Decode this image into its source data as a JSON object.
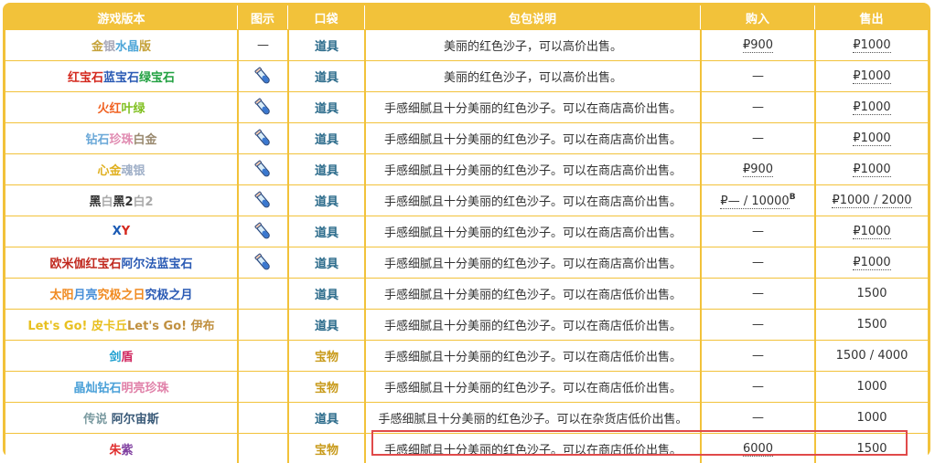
{
  "headers": [
    "游戏版本",
    "图示",
    "口袋",
    "包包说明",
    "购入",
    "售出"
  ],
  "rows": [
    {
      "version": [
        [
          "金",
          "#c5a23a"
        ],
        [
          "银",
          "#a8a8b8"
        ],
        [
          "水晶",
          "#4ea6d8"
        ],
        [
          "版",
          "#c5a23a"
        ]
      ],
      "icon": false,
      "icon_text": "—",
      "pocket": "道具",
      "pocket_type": "item",
      "desc": "美丽的红色沙子，可以高价出售。",
      "buy": "₽900",
      "sell": "₽1000"
    },
    {
      "version": [
        [
          "红宝石",
          "#d4281e"
        ],
        [
          "蓝宝石",
          "#2a5ab4"
        ],
        [
          "绿宝石",
          "#20a040"
        ]
      ],
      "icon": true,
      "pocket": "道具",
      "pocket_type": "item",
      "desc": "美丽的红色沙子，可以高价出售。",
      "buy": "—",
      "sell": "₽1000"
    },
    {
      "version": [
        [
          "火红",
          "#f06020"
        ],
        [
          "叶绿",
          "#80c020"
        ]
      ],
      "icon": true,
      "pocket": "道具",
      "pocket_type": "item",
      "desc": "手感细腻且十分美丽的红色沙子。可以在商店高价出售。",
      "buy": "—",
      "sell": "₽1000"
    },
    {
      "version": [
        [
          "钻石",
          "#6aa8d8"
        ],
        [
          "珍珠",
          "#e08ab0"
        ],
        [
          "白金",
          "#9a8a70"
        ]
      ],
      "icon": true,
      "pocket": "道具",
      "pocket_type": "item",
      "desc": "手感细腻且十分美丽的红色沙子。可以在商店高价出售。",
      "buy": "—",
      "sell": "₽1000"
    },
    {
      "version": [
        [
          "心金",
          "#e0b020"
        ],
        [
          "魂银",
          "#a0b0c8"
        ]
      ],
      "icon": true,
      "pocket": "道具",
      "pocket_type": "item",
      "desc": "手感细腻且十分美丽的红色沙子。可以在商店高价出售。",
      "buy": "₽900",
      "sell": "₽1000"
    },
    {
      "version": [
        [
          "黑",
          "#333333"
        ],
        [
          "白",
          "#aaaaaa"
        ],
        [
          "黑2",
          "#333333"
        ],
        [
          "白2",
          "#aaaaaa"
        ]
      ],
      "icon": true,
      "pocket": "道具",
      "pocket_type": "item",
      "desc": "手感细腻且十分美丽的红色沙子。可以在商店高价出售。",
      "buy": "₽— / 10000",
      "buy_sup": "B",
      "sell": "₽1000 / 2000"
    },
    {
      "version": [
        [
          "X",
          "#1a5ab4"
        ],
        [
          "Y",
          "#d4281e"
        ]
      ],
      "icon": true,
      "pocket": "道具",
      "pocket_type": "item",
      "desc": "手感细腻且十分美丽的红色沙子。可以在商店高价出售。",
      "buy": "—",
      "sell": "₽1000"
    },
    {
      "version": [
        [
          "欧米伽红宝石",
          "#c0281e"
        ],
        [
          "阿尔法蓝宝石",
          "#2a5ab4"
        ]
      ],
      "icon": true,
      "pocket": "道具",
      "pocket_type": "item",
      "desc": "手感细腻且十分美丽的红色沙子。可以在商店高价出售。",
      "buy": "—",
      "sell": "₽1000"
    },
    {
      "version": [
        [
          "太阳",
          "#f08a20"
        ],
        [
          "月亮",
          "#4a90d8"
        ],
        [
          "究极之日",
          "#f08a20"
        ],
        [
          "究极之月",
          "#2a5ab4"
        ]
      ],
      "icon": false,
      "pocket": "道具",
      "pocket_type": "item",
      "desc": "手感细腻且十分美丽的红色沙子。可以在商店低价出售。",
      "buy": "—",
      "sell": "1500"
    },
    {
      "version": [
        [
          "Let's Go! 皮卡丘",
          "#e8c020"
        ],
        [
          "Let's Go! 伊布",
          "#c09040"
        ]
      ],
      "icon": false,
      "pocket": "道具",
      "pocket_type": "item",
      "desc": "手感细腻且十分美丽的红色沙子。可以在商店低价出售。",
      "buy": "—",
      "sell": "1500"
    },
    {
      "version": [
        [
          "剑",
          "#20a0d0"
        ],
        [
          "盾",
          "#d02860"
        ]
      ],
      "icon": false,
      "pocket": "宝物",
      "pocket_type": "treasure",
      "desc": "手感细腻且十分美丽的红色沙子。可以在商店低价出售。",
      "buy": "—",
      "sell": "1500 / 4000"
    },
    {
      "version": [
        [
          "晶灿钻石",
          "#4aa0d8"
        ],
        [
          "明亮珍珠",
          "#e080a8"
        ]
      ],
      "icon": false,
      "pocket": "宝物",
      "pocket_type": "treasure",
      "desc": "手感细腻且十分美丽的红色沙子。可以在商店低价出售。",
      "buy": "—",
      "sell": "1000"
    },
    {
      "version": [
        [
          "传说 ",
          "#7a9aa0"
        ],
        [
          "阿尔宙斯",
          "#3a5a78"
        ]
      ],
      "icon": false,
      "pocket": "道具",
      "pocket_type": "item",
      "desc": "手感细腻且十分美丽的红色沙子。可以在杂货店低价出售。",
      "buy": "—",
      "sell": "1000"
    },
    {
      "version": [
        [
          "朱",
          "#e03030"
        ],
        [
          "紫",
          "#8040a0"
        ]
      ],
      "icon": false,
      "pocket": "宝物",
      "pocket_type": "treasure",
      "desc": "手感细腻且十分美丽的红色沙子。可以在商店低价出售。",
      "buy": "6000",
      "sell": "1500"
    }
  ]
}
